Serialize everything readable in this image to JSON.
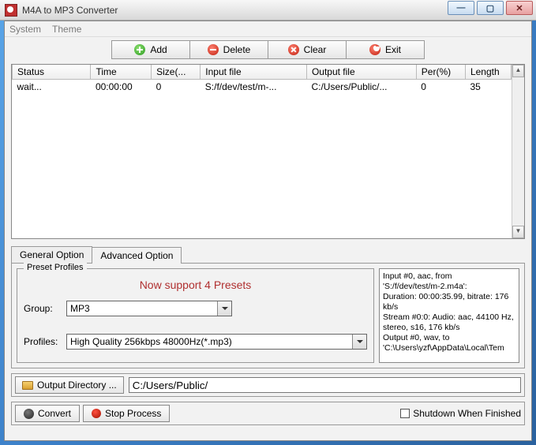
{
  "title": "M4A to MP3 Converter",
  "menu": {
    "system": "System",
    "theme": "Theme"
  },
  "toolbar": {
    "add": "Add",
    "delete": "Delete",
    "clear": "Clear",
    "exit": "Exit"
  },
  "columns": {
    "status": "Status",
    "time": "Time",
    "size": "Size(...",
    "input": "Input file",
    "output": "Output file",
    "per": "Per(%)",
    "length": "Length"
  },
  "rows": [
    {
      "status": "wait...",
      "time": "00:00:00",
      "size": "0",
      "input": "S:/f/dev/test/m-...",
      "output": "C:/Users/Public/...",
      "per": "0",
      "length": "35"
    }
  ],
  "tabs": {
    "general": "General Option",
    "advanced": "Advanced Option"
  },
  "preset": {
    "legend": "Preset Profiles",
    "title": "Now support 4 Presets",
    "group_label": "Group:",
    "group_value": "MP3",
    "profiles_label": "Profiles:",
    "profiles_value": "High Quality 256kbps 48000Hz(*.mp3)"
  },
  "info": "Input #0, aac, from\n'S:/f/dev/test/m-2.m4a':\n  Duration: 00:00:35.99, bitrate: 176 kb/s\n    Stream #0:0: Audio: aac, 44100 Hz, stereo, s16, 176 kb/s\nOutput #0, wav, to\n'C:\\Users\\yzf\\AppData\\Local\\Tem",
  "outdir": {
    "button": "Output Directory ...",
    "value": "C:/Users/Public/"
  },
  "bottom": {
    "convert": "Convert",
    "stop": "Stop Process",
    "shutdown": "Shutdown When Finished"
  }
}
